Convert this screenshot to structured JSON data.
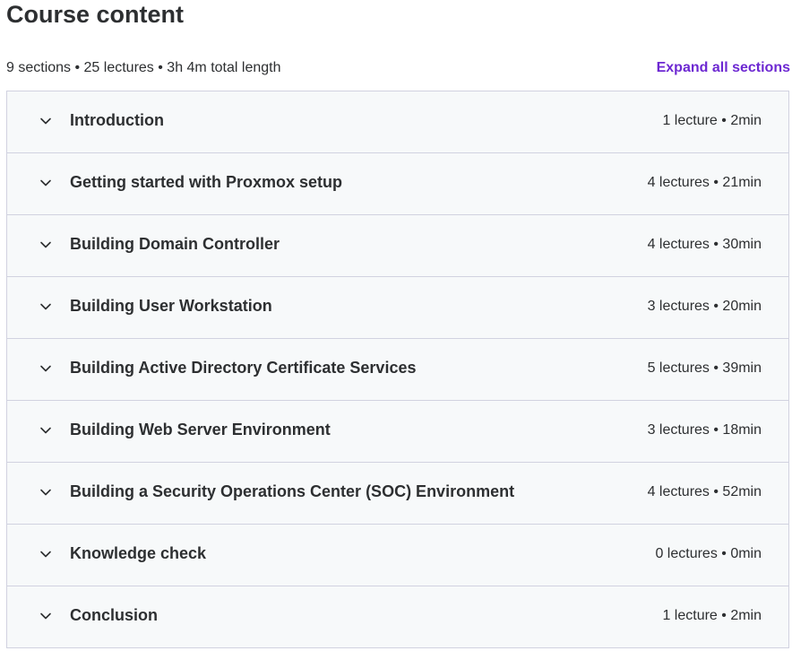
{
  "header": {
    "title": "Course content",
    "summary": "9 sections • 25 lectures • 3h 4m total length",
    "expand_all_label": "Expand all sections"
  },
  "sections": [
    {
      "title": "Introduction",
      "meta": "1 lecture • 2min"
    },
    {
      "title": "Getting started with Proxmox setup",
      "meta": "4 lectures • 21min"
    },
    {
      "title": "Building Domain Controller",
      "meta": "4 lectures • 30min"
    },
    {
      "title": "Building User Workstation",
      "meta": "3 lectures • 20min"
    },
    {
      "title": "Building Active Directory Certificate Services",
      "meta": "5 lectures • 39min"
    },
    {
      "title": "Building Web Server Environment",
      "meta": "3 lectures • 18min"
    },
    {
      "title": "Building a Security Operations Center (SOC) Environment",
      "meta": "4 lectures • 52min"
    },
    {
      "title": "Knowledge check",
      "meta": "0 lectures • 0min"
    },
    {
      "title": "Conclusion",
      "meta": "1 lecture • 2min"
    }
  ],
  "icons": {
    "section_toggle": "chevron-down-icon"
  },
  "colors": {
    "accent": "#6d28d2",
    "text": "#2d2f31",
    "section_bg": "#f7f9fa",
    "border": "#d1d2e0"
  }
}
